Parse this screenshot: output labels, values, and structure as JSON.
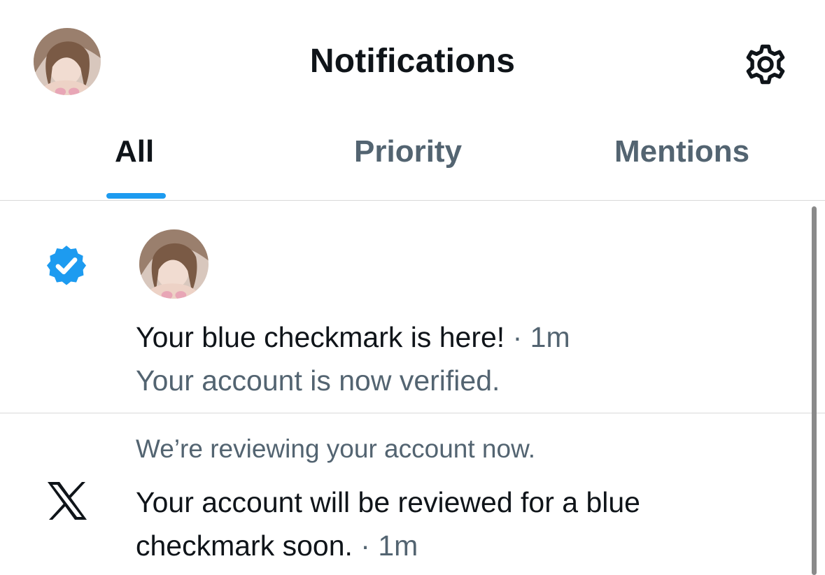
{
  "header": {
    "title": "Notifications",
    "profile_avatar": "profile-avatar",
    "settings_icon": "gear-icon"
  },
  "tabs": [
    {
      "label": "All",
      "active": true
    },
    {
      "label": "Priority",
      "active": false
    },
    {
      "label": "Mentions",
      "active": false
    }
  ],
  "notifications": [
    {
      "icon": "verified-badge-icon",
      "title": "Your blue checkmark is here!",
      "separator": " · ",
      "time": "1m",
      "subtitle": "Your account is now verified."
    },
    {
      "icon": "x-logo-icon",
      "preface": "We’re reviewing your account now.",
      "body_line_1": "Your account will be reviewed for a blue",
      "body_line_2": "checkmark soon.",
      "separator": " · ",
      "time": "1m"
    }
  ],
  "colors": {
    "accent": "#1d9bf0",
    "primary_text": "#0f1419",
    "secondary_text": "#536471",
    "divider": "#d9d9d9"
  }
}
